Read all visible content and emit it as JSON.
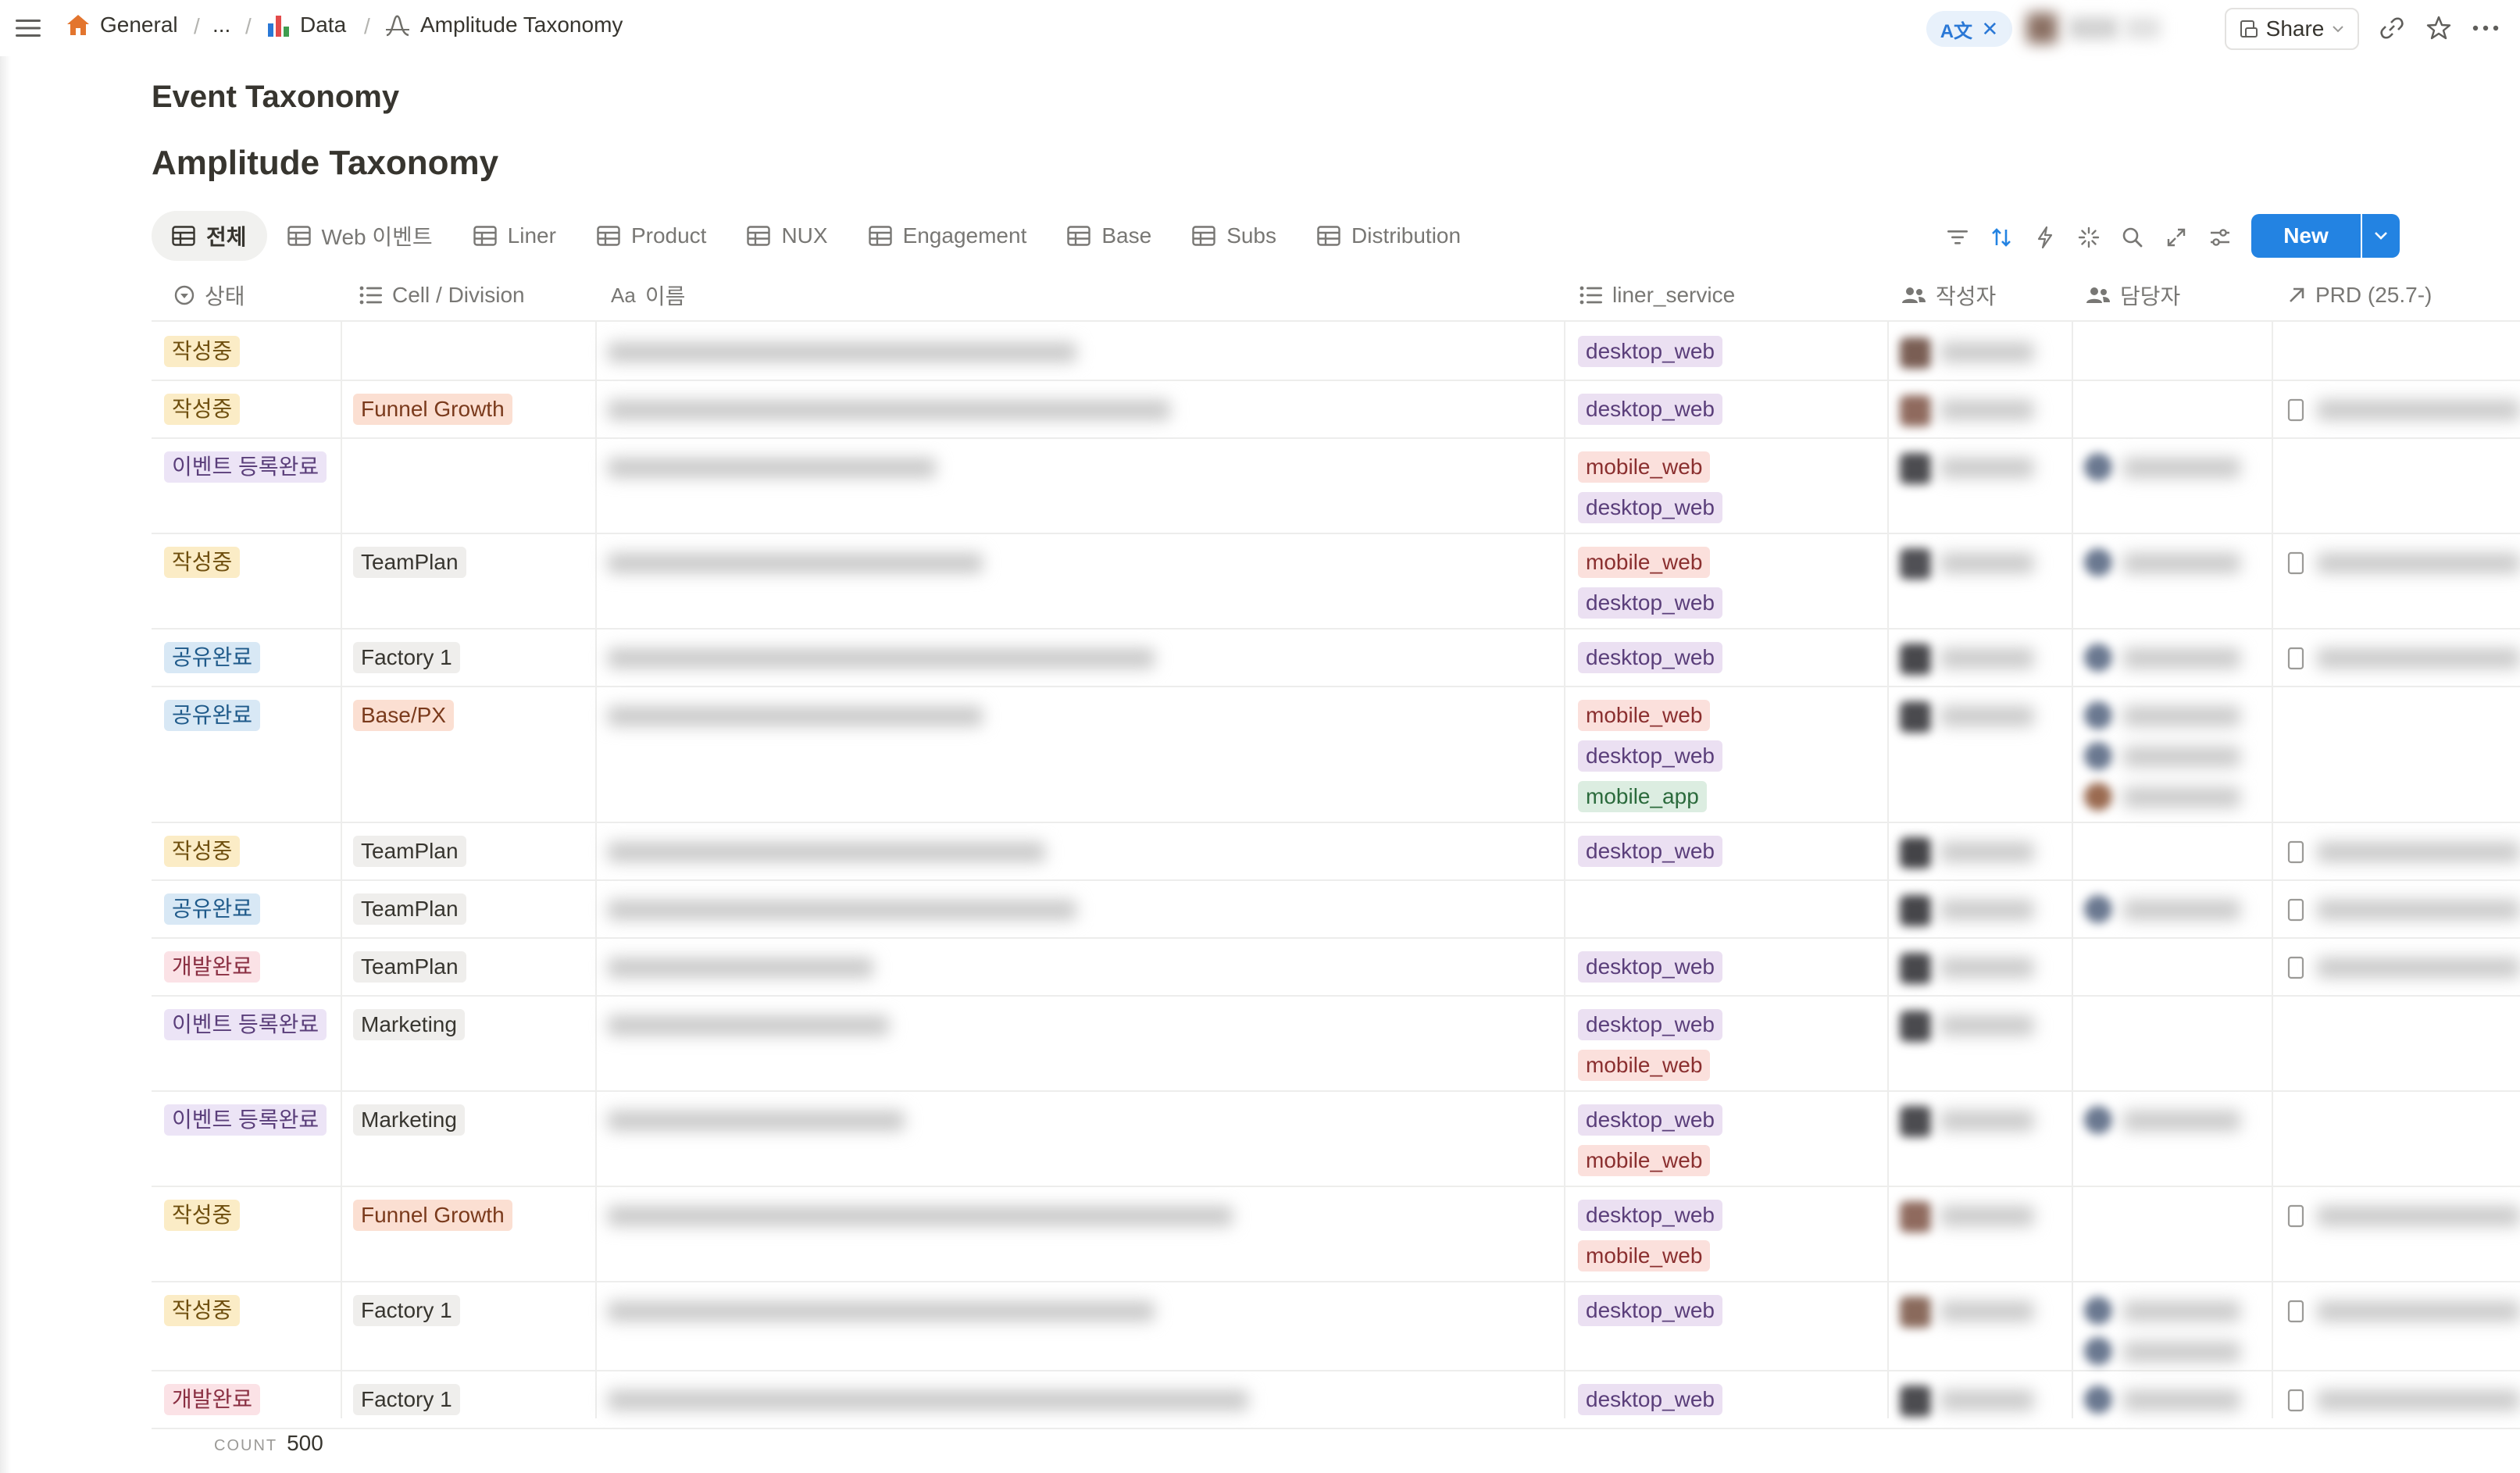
{
  "breadcrumb": {
    "workspace": "General",
    "ellipsis": "...",
    "parent": "Data",
    "current": "Amplitude Taxonomy"
  },
  "topbar": {
    "translate_label": "A文",
    "share_label": "Share"
  },
  "page": {
    "parent_title": "Event Taxonomy",
    "title": "Amplitude Taxonomy"
  },
  "tabs": [
    {
      "label": "전체",
      "active": true
    },
    {
      "label": "Web 이벤트"
    },
    {
      "label": "Liner"
    },
    {
      "label": "Product"
    },
    {
      "label": "NUX"
    },
    {
      "label": "Engagement"
    },
    {
      "label": "Base"
    },
    {
      "label": "Subs"
    },
    {
      "label": "Distribution"
    }
  ],
  "toolbar": {
    "new_label": "New"
  },
  "columns": {
    "status": "상태",
    "cell": "Cell / Division",
    "name": "이름",
    "name_prefix": "Aa",
    "service": "liner_service",
    "author": "작성자",
    "owner": "담당자",
    "prd": "PRD (25.7-)"
  },
  "colors": {
    "accent": "#2383e2",
    "status_writing_bg": "#fbecc6",
    "status_registered_bg": "#ece4f6",
    "status_shared_bg": "#d8e8f5",
    "status_devdone_bg": "#fbe2e6",
    "cell_orange_bg": "#fbdfd2",
    "cell_gray_bg": "#efeeec",
    "svc_desktop_bg": "#ebe0f2",
    "svc_mobile_web_bg": "#fbe0dc",
    "svc_mobile_app_bg": "#dcede1"
  },
  "rows": [
    {
      "status": "작성중",
      "cell": "",
      "services": [
        "desktop_web"
      ]
    },
    {
      "status": "작성중",
      "cell": "Funnel Growth",
      "services": [
        "desktop_web"
      ]
    },
    {
      "status": "이벤트 등록완료",
      "cell": "",
      "services": [
        "mobile_web",
        "desktop_web"
      ]
    },
    {
      "status": "작성중",
      "cell": "TeamPlan",
      "services": [
        "mobile_web",
        "desktop_web"
      ]
    },
    {
      "status": "공유완료",
      "cell": "Factory 1",
      "services": [
        "desktop_web"
      ]
    },
    {
      "status": "공유완료",
      "cell": "Base/PX",
      "services": [
        "mobile_web",
        "desktop_web",
        "mobile_app"
      ]
    },
    {
      "status": "작성중",
      "cell": "TeamPlan",
      "services": [
        "desktop_web"
      ]
    },
    {
      "status": "공유완료",
      "cell": "TeamPlan",
      "services": []
    },
    {
      "status": "개발완료",
      "cell": "TeamPlan",
      "services": [
        "desktop_web"
      ]
    },
    {
      "status": "이벤트 등록완료",
      "cell": "Marketing",
      "services": [
        "desktop_web",
        "mobile_web"
      ]
    },
    {
      "status": "이벤트 등록완료",
      "cell": "Marketing",
      "services": [
        "desktop_web",
        "mobile_web"
      ]
    },
    {
      "status": "작성중",
      "cell": "Funnel Growth",
      "services": [
        "desktop_web",
        "mobile_web"
      ]
    },
    {
      "status": "작성중",
      "cell": "Factory 1",
      "services": [
        "desktop_web"
      ]
    },
    {
      "status": "개발완료",
      "cell": "Factory 1",
      "services": [
        "desktop_web"
      ]
    }
  ],
  "footer": {
    "count_label": "COUNT",
    "count_value": "500"
  }
}
